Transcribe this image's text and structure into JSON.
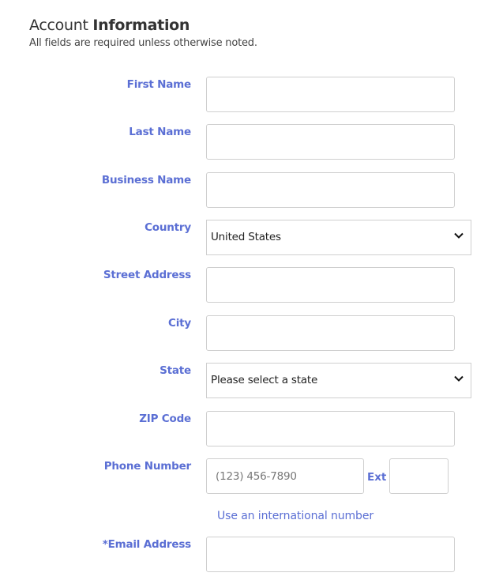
{
  "header": {
    "title_light": "Account",
    "title_bold": "Information",
    "subtitle": "All fields are required unless otherwise noted."
  },
  "form": {
    "first_name": {
      "label": "First Name",
      "value": ""
    },
    "last_name": {
      "label": "Last Name",
      "value": ""
    },
    "business_name": {
      "label": "Business Name",
      "value": ""
    },
    "country": {
      "label": "Country",
      "selected": "United States"
    },
    "street_address": {
      "label": "Street Address",
      "value": ""
    },
    "city": {
      "label": "City",
      "value": ""
    },
    "state": {
      "label": "State",
      "selected": "Please select a state"
    },
    "zip_code": {
      "label": "ZIP Code",
      "value": ""
    },
    "phone": {
      "label": "Phone Number",
      "placeholder": "(123) 456-7890",
      "value": "",
      "ext_label": "Ext",
      "ext_value": ""
    },
    "international_link": "Use an international number",
    "email": {
      "label": "*Email Address",
      "value": ""
    }
  },
  "colors": {
    "label": "#5b6fd4",
    "border": "#cfcfcf",
    "text": "#333333"
  }
}
